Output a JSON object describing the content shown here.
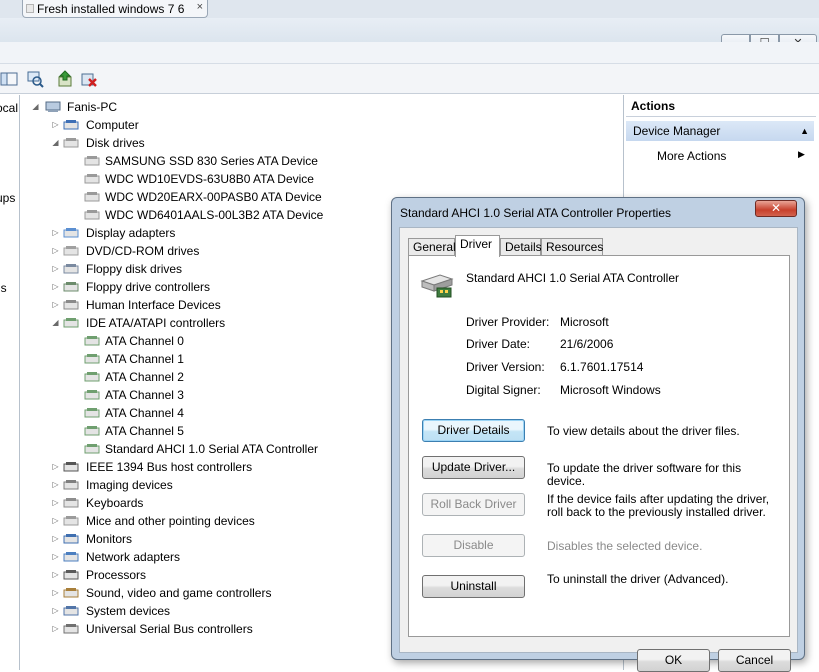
{
  "browser": {
    "tab_title": "Fresh installed windows 7 6",
    "tab_close": "×"
  },
  "window": {
    "min": "▁",
    "max": "☐",
    "close": "✕"
  },
  "scope": {
    "items": [
      "ocal",
      "ups",
      "ns"
    ]
  },
  "tree": {
    "root": "Fanis-PC",
    "nodes": [
      {
        "label": "Computer",
        "level": 1,
        "expander": "collapsed",
        "icon": "computer-icon"
      },
      {
        "label": "Disk drives",
        "level": 1,
        "expander": "expanded",
        "icon": "disk-drive-icon"
      },
      {
        "label": "SAMSUNG SSD 830 Series ATA Device",
        "level": 2,
        "expander": "none",
        "icon": "disk-drive-icon"
      },
      {
        "label": "WDC WD10EVDS-63U8B0 ATA Device",
        "level": 2,
        "expander": "none",
        "icon": "disk-drive-icon"
      },
      {
        "label": "WDC WD20EARX-00PASB0 ATA Device",
        "level": 2,
        "expander": "none",
        "icon": "disk-drive-icon"
      },
      {
        "label": "WDC WD6401AALS-00L3B2 ATA Device",
        "level": 2,
        "expander": "none",
        "icon": "disk-drive-icon"
      },
      {
        "label": "Display adapters",
        "level": 1,
        "expander": "collapsed",
        "icon": "display-adapter-icon"
      },
      {
        "label": "DVD/CD-ROM drives",
        "level": 1,
        "expander": "collapsed",
        "icon": "dvd-drive-icon"
      },
      {
        "label": "Floppy disk drives",
        "level": 1,
        "expander": "collapsed",
        "icon": "floppy-icon"
      },
      {
        "label": "Floppy drive controllers",
        "level": 1,
        "expander": "collapsed",
        "icon": "floppy-controller-icon"
      },
      {
        "label": "Human Interface Devices",
        "level": 1,
        "expander": "collapsed",
        "icon": "hid-icon"
      },
      {
        "label": "IDE ATA/ATAPI controllers",
        "level": 1,
        "expander": "expanded",
        "icon": "controller-icon"
      },
      {
        "label": "ATA Channel 0",
        "level": 2,
        "expander": "none",
        "icon": "controller-icon"
      },
      {
        "label": "ATA Channel 1",
        "level": 2,
        "expander": "none",
        "icon": "controller-icon"
      },
      {
        "label": "ATA Channel 2",
        "level": 2,
        "expander": "none",
        "icon": "controller-icon"
      },
      {
        "label": "ATA Channel 3",
        "level": 2,
        "expander": "none",
        "icon": "controller-icon"
      },
      {
        "label": "ATA Channel 4",
        "level": 2,
        "expander": "none",
        "icon": "controller-icon"
      },
      {
        "label": "ATA Channel 5",
        "level": 2,
        "expander": "none",
        "icon": "controller-icon"
      },
      {
        "label": "Standard AHCI 1.0 Serial ATA Controller",
        "level": 2,
        "expander": "none",
        "icon": "controller-icon"
      },
      {
        "label": "IEEE 1394 Bus host controllers",
        "level": 1,
        "expander": "collapsed",
        "icon": "ieee1394-icon"
      },
      {
        "label": "Imaging devices",
        "level": 1,
        "expander": "collapsed",
        "icon": "camera-icon"
      },
      {
        "label": "Keyboards",
        "level": 1,
        "expander": "collapsed",
        "icon": "keyboard-icon"
      },
      {
        "label": "Mice and other pointing devices",
        "level": 1,
        "expander": "collapsed",
        "icon": "mouse-icon"
      },
      {
        "label": "Monitors",
        "level": 1,
        "expander": "collapsed",
        "icon": "monitor-icon"
      },
      {
        "label": "Network adapters",
        "level": 1,
        "expander": "collapsed",
        "icon": "network-icon"
      },
      {
        "label": "Processors",
        "level": 1,
        "expander": "collapsed",
        "icon": "processor-icon"
      },
      {
        "label": "Sound, video and game controllers",
        "level": 1,
        "expander": "collapsed",
        "icon": "sound-icon"
      },
      {
        "label": "System devices",
        "level": 1,
        "expander": "collapsed",
        "icon": "system-device-icon"
      },
      {
        "label": "Universal Serial Bus controllers",
        "level": 1,
        "expander": "collapsed",
        "icon": "usb-icon"
      }
    ]
  },
  "actions": {
    "header": "Actions",
    "section": "Device Manager",
    "more": "More Actions"
  },
  "dialog": {
    "title": "Standard AHCI 1.0 Serial ATA Controller Properties",
    "close": "✕",
    "tabs": [
      "General",
      "Driver",
      "Details",
      "Resources"
    ],
    "active_tab": "Driver",
    "device_name": "Standard AHCI 1.0 Serial ATA Controller",
    "props": [
      {
        "label": "Driver Provider:",
        "value": "Microsoft"
      },
      {
        "label": "Driver Date:",
        "value": "21/6/2006"
      },
      {
        "label": "Driver Version:",
        "value": "6.1.7601.17514"
      },
      {
        "label": "Digital Signer:",
        "value": "Microsoft Windows"
      }
    ],
    "buttons": [
      {
        "label": "Driver Details",
        "desc": "To view details about the driver files.",
        "enabled": true,
        "focused": true
      },
      {
        "label": "Update Driver...",
        "desc": "To update the driver software for this device.",
        "enabled": true
      },
      {
        "label": "Roll Back Driver",
        "desc": "If the device fails after updating the driver, roll back to the previously installed driver.",
        "enabled": false
      },
      {
        "label": "Disable",
        "desc": "Disables the selected device.",
        "enabled": false
      },
      {
        "label": "Uninstall",
        "desc": "To uninstall the driver (Advanced).",
        "enabled": true
      }
    ],
    "ok": "OK",
    "cancel": "Cancel"
  }
}
